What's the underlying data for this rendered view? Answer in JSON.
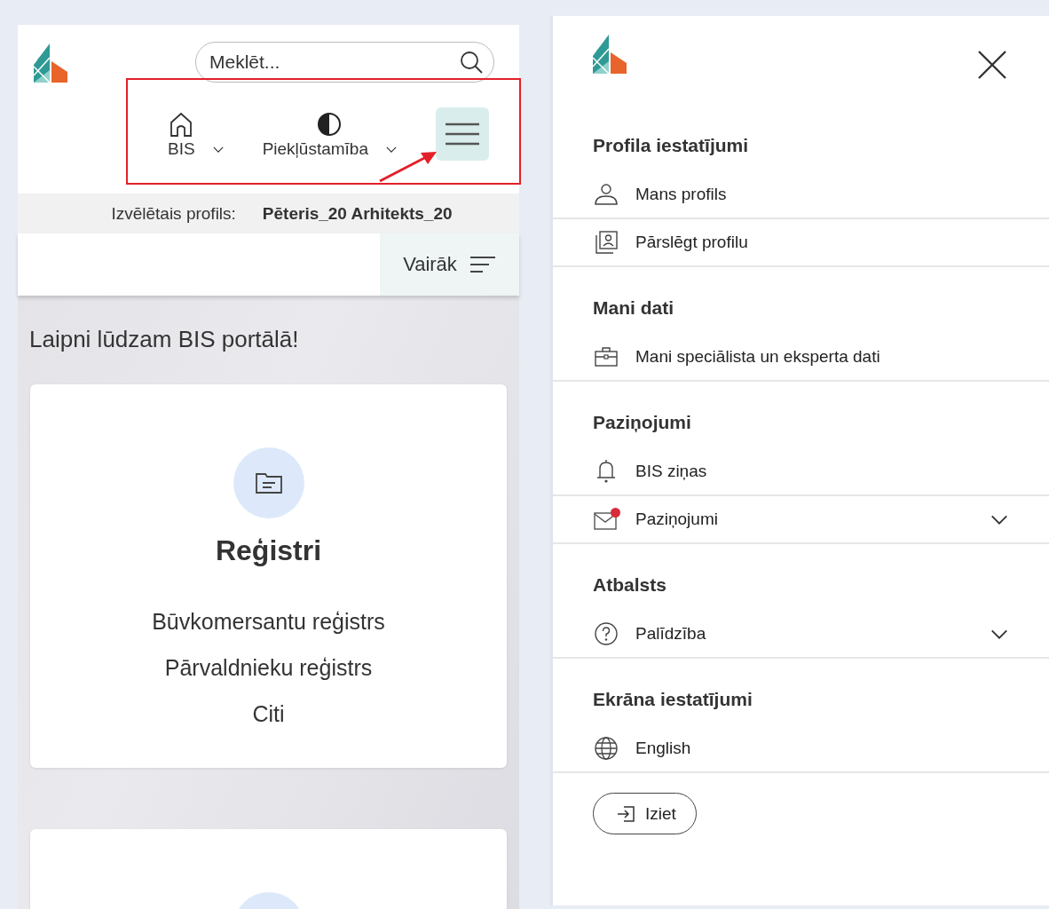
{
  "left_screen": {
    "search": {
      "placeholder": "Meklēt..."
    },
    "nav": [
      {
        "kind": "home",
        "label": "BIS",
        "dropdown": true
      },
      {
        "kind": "contrast",
        "label": "Piekļūstamība",
        "dropdown": true
      }
    ],
    "menu_button_highlighted": true,
    "profile_bar": {
      "label": "Izvēlētais profils:",
      "value": "Pēteris_20 Arhitekts_20"
    },
    "more_button": "Vairāk",
    "welcome": "Laipni lūdzam BIS portālā!",
    "cards": [
      {
        "title": "Reģistri",
        "links": [
          "Būvkomersantu reģistrs",
          "Pārvaldnieku reģistrs",
          "Citi"
        ]
      }
    ]
  },
  "menu_drawer": {
    "sections": [
      {
        "heading": "Profila iestatījumi",
        "items": [
          {
            "kind": "profile",
            "label": "Mans profils",
            "expandable": false,
            "unread": false
          },
          {
            "kind": "switch",
            "label": "Pārslēgt profilu",
            "expandable": false,
            "unread": false
          }
        ]
      },
      {
        "heading": "Mani dati",
        "items": [
          {
            "kind": "data",
            "label": "Mani speciālista un eksperta dati",
            "expandable": false,
            "unread": false
          }
        ]
      },
      {
        "heading": "Paziņojumi",
        "items": [
          {
            "kind": "news",
            "label": "BIS ziņas",
            "expandable": false,
            "unread": false
          },
          {
            "kind": "messages",
            "label": "Paziņojumi",
            "expandable": true,
            "unread": true
          }
        ]
      },
      {
        "heading": "Atbalsts",
        "items": [
          {
            "kind": "help",
            "label": "Palīdzība",
            "expandable": true,
            "unread": false
          }
        ]
      },
      {
        "heading": "Ekrāna iestatījumi",
        "items": [
          {
            "kind": "language",
            "label": "English",
            "expandable": false,
            "unread": false
          }
        ]
      }
    ],
    "logout": "Iziet"
  }
}
